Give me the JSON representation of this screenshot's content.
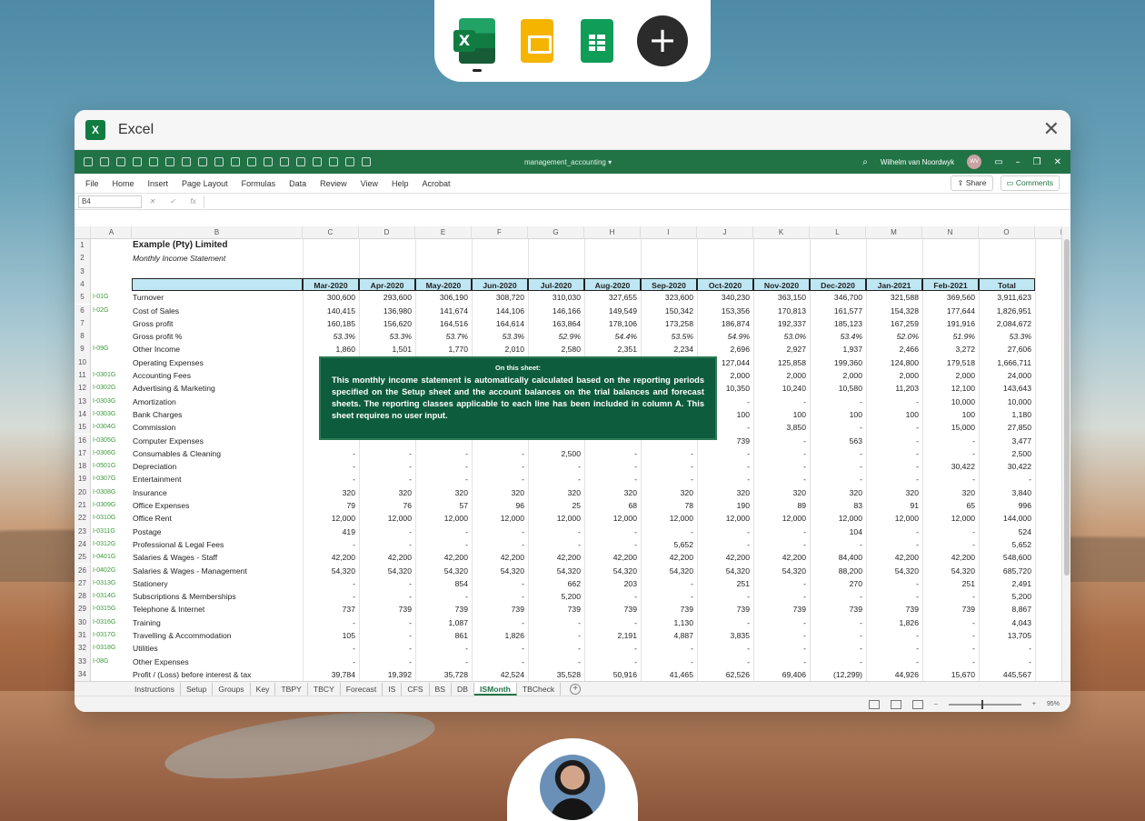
{
  "window": {
    "title": "Excel"
  },
  "excel": {
    "document_name": "management_accounting",
    "user_name": "Wilhelm van Noordwyk",
    "user_initials": "WV",
    "ribbon_tabs": [
      "File",
      "Home",
      "Insert",
      "Page Layout",
      "Formulas",
      "Data",
      "Review",
      "View",
      "Help",
      "Acrobat"
    ],
    "share_label": "Share",
    "comments_label": "Comments",
    "name_box": "B4",
    "zoom": "95%"
  },
  "column_letters": [
    "A",
    "B",
    "C",
    "D",
    "E",
    "F",
    "G",
    "H",
    "I",
    "J",
    "K",
    "L",
    "M",
    "N",
    "O",
    "P"
  ],
  "sheet": {
    "title": "Example (Pty) Limited",
    "subtitle": "Monthly Income Statement",
    "headers": [
      "Mar-2020",
      "Apr-2020",
      "May-2020",
      "Jun-2020",
      "Jul-2020",
      "Aug-2020",
      "Sep-2020",
      "Oct-2020",
      "Nov-2020",
      "Dec-2020",
      "Jan-2021",
      "Feb-2021",
      "Total"
    ],
    "rows": [
      {
        "n": "5",
        "code": "I-01G",
        "label": "Turnover",
        "vals": [
          "300,600",
          "293,600",
          "306,190",
          "308,720",
          "310,030",
          "327,655",
          "323,600",
          "340,230",
          "363,150",
          "346,700",
          "321,588",
          "369,560",
          "3,911,623"
        ]
      },
      {
        "n": "6",
        "code": "I-02G",
        "label": "Cost of Sales",
        "vals": [
          "140,415",
          "136,980",
          "141,674",
          "144,106",
          "146,166",
          "149,549",
          "150,342",
          "153,356",
          "170,813",
          "161,577",
          "154,328",
          "177,644",
          "1,826,951"
        ]
      },
      {
        "n": "7",
        "code": "",
        "label": "Gross profit",
        "vals": [
          "160,185",
          "156,620",
          "164,516",
          "164,614",
          "163,864",
          "178,106",
          "173,258",
          "186,874",
          "192,337",
          "185,123",
          "167,259",
          "191,916",
          "2,084,672"
        ]
      },
      {
        "n": "8",
        "code": "",
        "label": "Gross profit %",
        "pct": true,
        "vals": [
          "53.3%",
          "53.3%",
          "53.7%",
          "53.3%",
          "52.9%",
          "54.4%",
          "53.5%",
          "54.9%",
          "53.0%",
          "53.4%",
          "52.0%",
          "51.9%",
          "53.3%"
        ]
      },
      {
        "n": "9",
        "code": "I-09G",
        "label": "Other Income",
        "vals": [
          "1,860",
          "1,501",
          "1,770",
          "2,010",
          "2,580",
          "2,351",
          "2,234",
          "2,696",
          "2,927",
          "1,937",
          "2,466",
          "3,272",
          "27,606"
        ]
      },
      {
        "n": "10",
        "code": "",
        "label": "Operating Expenses",
        "vals": [
          "",
          "",
          "",
          "",
          "",
          "",
          "",
          "127,044",
          "125,858",
          "199,360",
          "124,800",
          "179,518",
          "1,666,711"
        ]
      },
      {
        "n": "11",
        "code": "I-0301G",
        "label": "Accounting Fees",
        "vals": [
          "",
          "",
          "",
          "",
          "",
          "",
          "",
          "2,000",
          "2,000",
          "2,000",
          "2,000",
          "2,000",
          "24,000"
        ]
      },
      {
        "n": "12",
        "code": "I-0302G",
        "label": "Advertising & Marketing",
        "vals": [
          "",
          "",
          "",
          "",
          "",
          "",
          "",
          "10,350",
          "10,240",
          "10,580",
          "11,203",
          "12,100",
          "143,643"
        ]
      },
      {
        "n": "13",
        "code": "I-0303G",
        "label": "Amortization",
        "vals": [
          "",
          "",
          "",
          "",
          "",
          "",
          "",
          "-",
          "-",
          "-",
          "-",
          "10,000",
          "10,000"
        ]
      },
      {
        "n": "14",
        "code": "I-0303G",
        "label": "Bank Charges",
        "vals": [
          "",
          "",
          "",
          "",
          "",
          "",
          "",
          "100",
          "100",
          "100",
          "100",
          "100",
          "1,180"
        ]
      },
      {
        "n": "15",
        "code": "I-0304G",
        "label": "Commission",
        "vals": [
          "",
          "",
          "",
          "",
          "",
          "",
          "",
          "-",
          "3,850",
          "-",
          "-",
          "15,000",
          "27,850"
        ]
      },
      {
        "n": "16",
        "code": "I-0305G",
        "label": "Computer Expenses",
        "vals": [
          "",
          "",
          "",
          "",
          "",
          "",
          "",
          "739",
          "-",
          "563",
          "-",
          "-",
          "3,477"
        ]
      },
      {
        "n": "17",
        "code": "I-0306G",
        "label": "Consumables & Cleaning",
        "vals": [
          "-",
          "-",
          "-",
          "-",
          "2,500",
          "-",
          "-",
          "-",
          "-",
          "-",
          "-",
          "-",
          "2,500"
        ]
      },
      {
        "n": "18",
        "code": "I-0501G",
        "label": "Depreciation",
        "vals": [
          "-",
          "-",
          "-",
          "-",
          "-",
          "-",
          "-",
          "-",
          "-",
          "-",
          "-",
          "30,422",
          "30,422"
        ]
      },
      {
        "n": "19",
        "code": "I-0307G",
        "label": "Entertainment",
        "vals": [
          "-",
          "-",
          "-",
          "-",
          "-",
          "-",
          "-",
          "-",
          "-",
          "-",
          "-",
          "-",
          "-"
        ]
      },
      {
        "n": "20",
        "code": "I-0308G",
        "label": "Insurance",
        "vals": [
          "320",
          "320",
          "320",
          "320",
          "320",
          "320",
          "320",
          "320",
          "320",
          "320",
          "320",
          "320",
          "3,840"
        ]
      },
      {
        "n": "21",
        "code": "I-0309G",
        "label": "Office Expenses",
        "vals": [
          "79",
          "76",
          "57",
          "96",
          "25",
          "68",
          "78",
          "190",
          "89",
          "83",
          "91",
          "65",
          "996"
        ]
      },
      {
        "n": "22",
        "code": "I-0310G",
        "label": "Office Rent",
        "vals": [
          "12,000",
          "12,000",
          "12,000",
          "12,000",
          "12,000",
          "12,000",
          "12,000",
          "12,000",
          "12,000",
          "12,000",
          "12,000",
          "12,000",
          "144,000"
        ]
      },
      {
        "n": "23",
        "code": "I-0311G",
        "label": "Postage",
        "vals": [
          "419",
          "-",
          "-",
          "-",
          "-",
          "-",
          "-",
          "-",
          "-",
          "104",
          "-",
          "-",
          "524"
        ]
      },
      {
        "n": "24",
        "code": "I-0312G",
        "label": "Professional & Legal Fees",
        "vals": [
          "-",
          "-",
          "-",
          "-",
          "-",
          "-",
          "5,652",
          "-",
          "-",
          "-",
          "-",
          "-",
          "5,652"
        ]
      },
      {
        "n": "25",
        "code": "I-0401G",
        "label": "Salaries & Wages - Staff",
        "vals": [
          "42,200",
          "42,200",
          "42,200",
          "42,200",
          "42,200",
          "42,200",
          "42,200",
          "42,200",
          "42,200",
          "84,400",
          "42,200",
          "42,200",
          "548,600"
        ]
      },
      {
        "n": "26",
        "code": "I-0402G",
        "label": "Salaries & Wages - Management",
        "vals": [
          "54,320",
          "54,320",
          "54,320",
          "54,320",
          "54,320",
          "54,320",
          "54,320",
          "54,320",
          "54,320",
          "88,200",
          "54,320",
          "54,320",
          "685,720"
        ]
      },
      {
        "n": "27",
        "code": "I-0313G",
        "label": "Stationery",
        "vals": [
          "-",
          "-",
          "854",
          "-",
          "662",
          "203",
          "-",
          "251",
          "-",
          "270",
          "-",
          "251",
          "2,491"
        ]
      },
      {
        "n": "28",
        "code": "I-0314G",
        "label": "Subscriptions & Memberships",
        "vals": [
          "-",
          "-",
          "-",
          "-",
          "5,200",
          "-",
          "-",
          "-",
          "-",
          "-",
          "-",
          "-",
          "5,200"
        ]
      },
      {
        "n": "29",
        "code": "I-0315G",
        "label": "Telephone & Internet",
        "vals": [
          "737",
          "739",
          "739",
          "739",
          "739",
          "739",
          "739",
          "739",
          "739",
          "739",
          "739",
          "739",
          "8,867"
        ]
      },
      {
        "n": "30",
        "code": "I-0316G",
        "label": "Training",
        "vals": [
          "-",
          "-",
          "1,087",
          "-",
          "-",
          "-",
          "1,130",
          "-",
          "-",
          "-",
          "1,826",
          "-",
          "4,043"
        ]
      },
      {
        "n": "31",
        "code": "I-0317G",
        "label": "Travelling & Accommodation",
        "vals": [
          "105",
          "-",
          "861",
          "1,826",
          "-",
          "2,191",
          "4,887",
          "3,835",
          "-",
          "-",
          "-",
          "-",
          "13,705"
        ]
      },
      {
        "n": "32",
        "code": "I-0318G",
        "label": "Utilities",
        "vals": [
          "-",
          "-",
          "-",
          "-",
          "-",
          "-",
          "-",
          "-",
          "-",
          "-",
          "-",
          "-",
          "-"
        ]
      },
      {
        "n": "33",
        "code": "I-08G",
        "label": "Other Expenses",
        "vals": [
          "-",
          "-",
          "-",
          "-",
          "-",
          "-",
          "-",
          "-",
          "-",
          "-",
          "-",
          "-",
          "-"
        ]
      },
      {
        "n": "34",
        "code": "",
        "label": "Profit / (Loss) before interest & tax",
        "vals": [
          "39,784",
          "19,392",
          "35,728",
          "42,524",
          "35,528",
          "50,916",
          "41,465",
          "62,526",
          "69,406",
          "(12,299)",
          "44,926",
          "15,670",
          "445,567"
        ]
      }
    ]
  },
  "note": {
    "title": "On this sheet:",
    "body": "This monthly income statement is automatically calculated based on the reporting periods specified on the Setup sheet and the account balances on the trial balances and forecast sheets. The reporting classes applicable to each line has been included in column A. This sheet requires no user input."
  },
  "sheet_tabs": [
    "Instructions",
    "Setup",
    "Groups",
    "Key",
    "TBPY",
    "TBCY",
    "Forecast",
    "IS",
    "CFS",
    "BS",
    "DB",
    "ISMonth",
    "TBCheck"
  ],
  "active_tab": "ISMonth"
}
